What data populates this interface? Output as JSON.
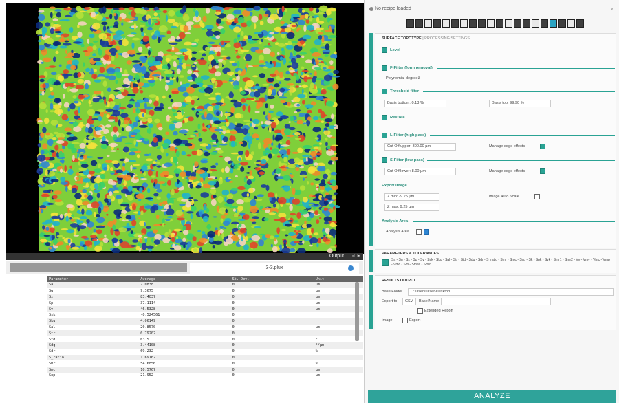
{
  "window": {
    "title": "No recipe loaded"
  },
  "viewer": {
    "output_label": "Output"
  },
  "tabs": {
    "active_label": "3-3.plux"
  },
  "table": {
    "headers": [
      "Parameter",
      "Average",
      "St. Dev.",
      "Unit"
    ],
    "rows": [
      [
        "Sa",
        "7.0838",
        "0",
        "µm"
      ],
      [
        "Sq",
        "9.3675",
        "0",
        "µm"
      ],
      [
        "Sz",
        "83.4037",
        "0",
        "µm"
      ],
      [
        "Sp",
        "37.1114",
        "0",
        "µm"
      ],
      [
        "Sv",
        "46.5328",
        "0",
        "µm"
      ],
      [
        "Ssk",
        "-0.524561",
        "0",
        ""
      ],
      [
        "Sku",
        "4.06149",
        "0",
        ""
      ],
      [
        "Sal",
        "20.8570",
        "0",
        "µm"
      ],
      [
        "Str",
        "0.79202",
        "0",
        ""
      ],
      [
        "Std",
        "63.5",
        "0",
        "°"
      ],
      [
        "Sdq",
        "3.44108",
        "0",
        "°/µm"
      ],
      [
        "Sdr",
        "69.232",
        "0",
        "%"
      ],
      [
        "S_ratio",
        "1.69162",
        "0",
        ""
      ],
      [
        "Smr",
        "54.6856",
        "0",
        "%"
      ],
      [
        "Smc",
        "10.5767",
        "0",
        "µm"
      ],
      [
        "Sxp",
        "21.952",
        "0",
        "µm"
      ]
    ]
  },
  "settings": {
    "tab_surface": "SURFACE TOPOTYPE",
    "tab_processing": "PROCESSING SETTINGS",
    "level_label": "Level",
    "ffilter_label": "F-Filter (form removal)",
    "poly_label": "Polynomial degree:",
    "poly_value": "3",
    "threshold_label": "Threshold filter",
    "basis_bottom_label": "Basis bottom:",
    "basis_bottom_value": "0.13 %",
    "basis_top_label": "Basis top:",
    "basis_top_value": "99.90 %",
    "restore_label": "Restore",
    "lfilter_high_label": "L-Filter (high pass)",
    "cutoff_upper_label": "Cut Off upper:",
    "cutoff_upper_value": "300.00 µm",
    "manage_edge_label_1": "Manage edge effects",
    "sfilter_low_label": "S-Filter (low pass)",
    "cutoff_lower_label": "Cut Off lower:",
    "cutoff_lower_value": "8.00 µm",
    "manage_edge_label_2": "Manage edge effects",
    "export_image_label": "Export Image",
    "zmin_label": "Z min:",
    "zmin_value": "-9.25 µm",
    "zmax_label": "Z max:",
    "zmax_value": "9.25 µm",
    "auto_scale_label": "Image Auto Scale",
    "analysis_area_header": "Analysis Area",
    "analysis_area_label": "Analysis Area"
  },
  "params": {
    "header": "PARAMETERS & TOLERANCES",
    "list": "Sa - Sq - Sz - Sp - Sv - Ssk - Sku - Sal - Str - Std - Sdq - Sdr - S_ratio - Smr - Smc - Sxp - Sk - Spk - Svk - Smr1 - Smr2 - Vv - Vmv - Vmc - Vmp - Vmc - Sm - Smax - Smin"
  },
  "output": {
    "header": "RESULTS OUTPUT",
    "base_folder_label": "Base Folder",
    "base_folder_value": "C:\\Users\\User\\Desktop",
    "export_to_label": "Export to",
    "export_format": "CSV",
    "base_name_label": "Base Name",
    "extended_report_label": "Extended Report",
    "image_label": "Image",
    "export_label": "Export"
  },
  "analyze_button": "ANALYZE",
  "colors": {
    "accent": "#2aa394",
    "blue": "#2f86d3"
  }
}
